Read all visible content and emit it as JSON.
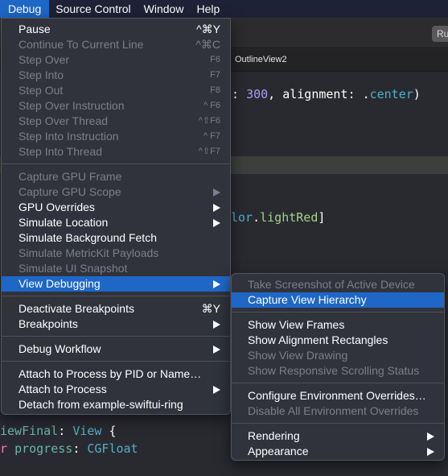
{
  "menubar": {
    "items": [
      {
        "label": "Debug",
        "active": true
      },
      {
        "label": "Source Control"
      },
      {
        "label": "Window"
      },
      {
        "label": "Help"
      }
    ]
  },
  "toolbar": {
    "run_label": "Ru"
  },
  "tabbar": {
    "active_tab": "OutlineView2"
  },
  "editor": {
    "line1": {
      "prefix": ": ",
      "number": "300",
      "middle": ", alignment: ",
      "dot": ".",
      "value": "center",
      "suffix": ")"
    },
    "line2": {
      "prefix": "lor",
      "dot": ".",
      "value": "lightRed",
      "suffix": "]"
    },
    "line3": {
      "name": "iewFinal",
      "colon": ": ",
      "type": "View",
      "brace": " {"
    },
    "line4": {
      "kw": "r",
      "space": " ",
      "name": "progress",
      "colon": ": ",
      "type": "CGFloat"
    }
  },
  "debug_menu": {
    "groups": [
      [
        {
          "label": "Pause",
          "shortcut": "^⌘Y",
          "enabled": true
        },
        {
          "label": "Continue To Current Line",
          "shortcut": "^⌘C",
          "enabled": false
        },
        {
          "label": "Step Over",
          "shortcut": "F6",
          "enabled": false
        },
        {
          "label": "Step Into",
          "shortcut": "F7",
          "enabled": false
        },
        {
          "label": "Step Out",
          "shortcut": "F8",
          "enabled": false
        },
        {
          "label": "Step Over Instruction",
          "shortcut": "^ F6",
          "enabled": false
        },
        {
          "label": "Step Over Thread",
          "shortcut": "^⇧F6",
          "enabled": false
        },
        {
          "label": "Step Into Instruction",
          "shortcut": "^ F7",
          "enabled": false
        },
        {
          "label": "Step Into Thread",
          "shortcut": "^⇧F7",
          "enabled": false
        }
      ],
      [
        {
          "label": "Capture GPU Frame",
          "enabled": false
        },
        {
          "label": "Capture GPU Scope",
          "enabled": false,
          "submenu": true
        },
        {
          "label": "GPU Overrides",
          "enabled": true,
          "submenu": true
        },
        {
          "label": "Simulate Location",
          "enabled": true,
          "submenu": true
        },
        {
          "label": "Simulate Background Fetch",
          "enabled": true
        },
        {
          "label": "Simulate MetricKit Payloads",
          "enabled": false
        },
        {
          "label": "Simulate UI Snapshot",
          "enabled": false
        },
        {
          "label": "View Debugging",
          "enabled": true,
          "submenu": true,
          "selected": true
        }
      ],
      [
        {
          "label": "Deactivate Breakpoints",
          "shortcut": "⌘Y",
          "enabled": true
        },
        {
          "label": "Breakpoints",
          "enabled": true,
          "submenu": true
        }
      ],
      [
        {
          "label": "Debug Workflow",
          "enabled": true,
          "submenu": true
        }
      ],
      [
        {
          "label": "Attach to Process by PID or Name…",
          "enabled": true
        },
        {
          "label": "Attach to Process",
          "enabled": true,
          "submenu": true
        },
        {
          "label": "Detach from example-swiftui-ring",
          "enabled": true
        }
      ]
    ]
  },
  "view_debugging_submenu": {
    "groups": [
      [
        {
          "label": "Take Screenshot of Active Device",
          "enabled": false
        },
        {
          "label": "Capture View Hierarchy",
          "enabled": true,
          "selected": true
        }
      ],
      [
        {
          "label": "Show View Frames",
          "enabled": true
        },
        {
          "label": "Show Alignment Rectangles",
          "enabled": true
        },
        {
          "label": "Show View Drawing",
          "enabled": false
        },
        {
          "label": "Show Responsive Scrolling Status",
          "enabled": false
        }
      ],
      [
        {
          "label": "Configure Environment Overrides…",
          "enabled": true
        },
        {
          "label": "Disable All Environment Overrides",
          "enabled": false
        }
      ],
      [
        {
          "label": "Rendering",
          "enabled": true,
          "submenu": true
        },
        {
          "label": "Appearance",
          "enabled": true,
          "submenu": true
        }
      ]
    ]
  },
  "colors": {
    "accent": "#1e67c7",
    "menubar_bg": "#1d2236",
    "menu_bg": "#30333c",
    "disabled_text": "#7c7f86",
    "editor_bg": "#292a30"
  }
}
